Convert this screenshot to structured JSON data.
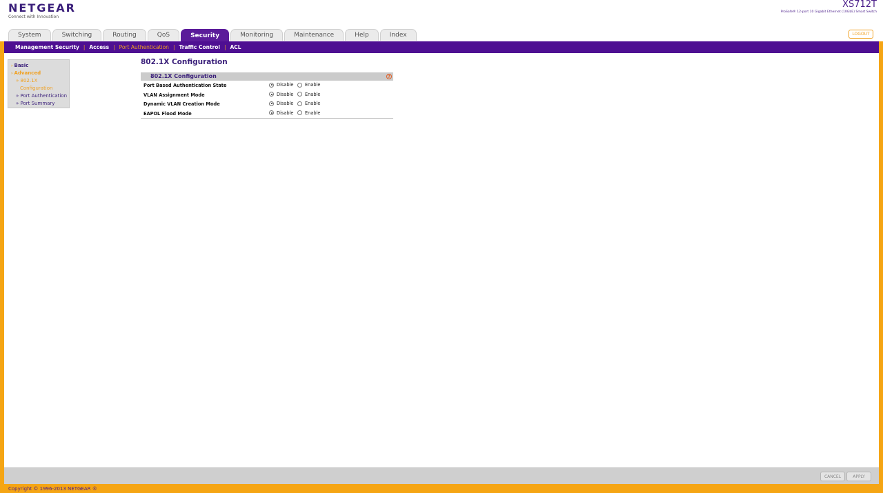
{
  "header": {
    "logo_name": "NETGEAR",
    "logo_tagline": "Connect with Innovation",
    "model": "XS712T",
    "model_desc": "ProSafe® 12-port 10 Gigabit Ethernet (10GbE) Smart Switch",
    "logout_label": "LOGOUT"
  },
  "tabs": [
    {
      "label": "System"
    },
    {
      "label": "Switching"
    },
    {
      "label": "Routing"
    },
    {
      "label": "QoS"
    },
    {
      "label": "Security",
      "active": true
    },
    {
      "label": "Monitoring"
    },
    {
      "label": "Maintenance"
    },
    {
      "label": "Help"
    },
    {
      "label": "Index"
    }
  ],
  "subnav": [
    {
      "label": "Management Security"
    },
    {
      "label": "Access"
    },
    {
      "label": "Port Authentication",
      "active": true
    },
    {
      "label": "Traffic Control"
    },
    {
      "label": "ACL"
    }
  ],
  "leftmenu": {
    "basic": "Basic",
    "advanced": "Advanced",
    "item_8021x_line1": "802.1X",
    "item_8021x_line2": "Configuration",
    "item_port_auth": "Port Authentication",
    "item_port_summary": "Port Summary"
  },
  "main": {
    "page_title": "802.1X Configuration",
    "section_title": "802.1X Configuration",
    "help_icon": "?",
    "option_disable": "Disable",
    "option_enable": "Enable",
    "rows": [
      {
        "label": "Port Based Authentication State",
        "value": "Disable"
      },
      {
        "label": "VLAN Assignment Mode",
        "value": "Disable"
      },
      {
        "label": "Dynamic VLAN Creation Mode",
        "value": "Disable"
      },
      {
        "label": "EAPOL Flood Mode",
        "value": "Disable"
      }
    ]
  },
  "actions": {
    "cancel": "CANCEL",
    "apply": "APPLY"
  },
  "footer": {
    "copyright": "Copyright © 1996-2013 NETGEAR ®"
  },
  "colors": {
    "brand_purple": "#4e0f92",
    "accent_orange": "#f5a514"
  }
}
